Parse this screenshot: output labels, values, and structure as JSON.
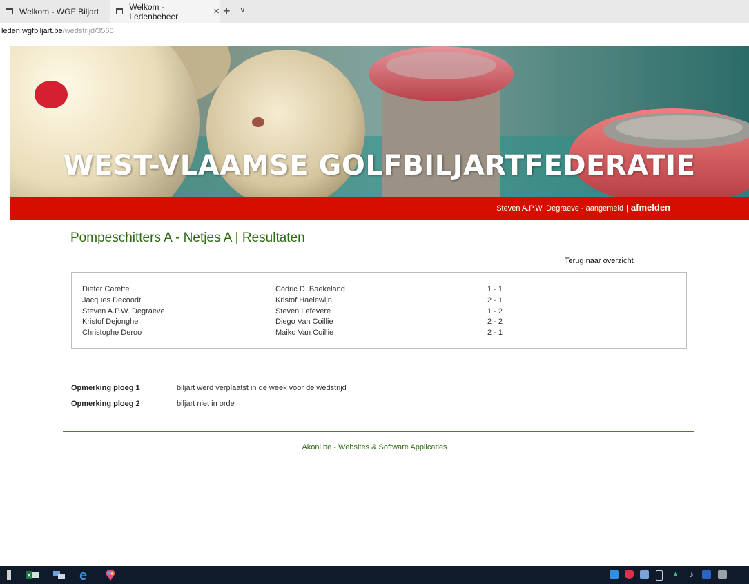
{
  "browser": {
    "tabs": [
      {
        "title": "Welkom - WGF Biljart"
      },
      {
        "title": "Welkom - Ledenbeheer",
        "close": "×"
      }
    ],
    "new_tab": "+",
    "tab_menu": "∨",
    "url_host": "leden.wgfbiljart.be",
    "url_path": "/wedstrijd/3560"
  },
  "header": {
    "banner_title": "WEST-VLAAMSE GOLFBILJARTFEDERATIE",
    "user_text": "Steven A.P.W. Degraeve - aangemeld",
    "separator": "|",
    "logout_label": "afmelden",
    "colors": {
      "bar": "#d60e00",
      "title_green": "#2e6a12"
    }
  },
  "main": {
    "title": "Pompeschitters A - Netjes A | Resultaten",
    "back_link": "Terug naar overzicht",
    "results": [
      {
        "home": "Dieter Carette",
        "away": "Cédric D. Baekeland",
        "score": "1 - 1"
      },
      {
        "home": "Jacques Decoodt",
        "away": "Kristof Haelewijn",
        "score": "2 - 1"
      },
      {
        "home": "Steven A.P.W. Degraeve",
        "away": "Steven Lefevere",
        "score": "1 - 2"
      },
      {
        "home": "Kristof Dejonghe",
        "away": "Diego Van Coillie",
        "score": "2 - 2"
      },
      {
        "home": "Christophe Deroo",
        "away": "Maiko Van Coillie",
        "score": "2 - 1"
      }
    ],
    "remarks": [
      {
        "label": "Opmerking ploeg 1",
        "text": "biljart werd verplaatst in de week voor de wedstrijd"
      },
      {
        "label": "Opmerking ploeg 2",
        "text": "biljart niet in orde"
      }
    ]
  },
  "footer": {
    "credit": "Akoni.be - Websites & Software Applicaties"
  },
  "taskbar": {
    "apps": [
      "excel-icon",
      "network-icon",
      "edge-icon",
      "paint-icon"
    ],
    "tray": [
      "cloud-icon",
      "shield-icon",
      "network-icon",
      "usb-icon",
      "drive-icon",
      "acrobat-icon",
      "word-icon",
      "notes-icon"
    ]
  }
}
